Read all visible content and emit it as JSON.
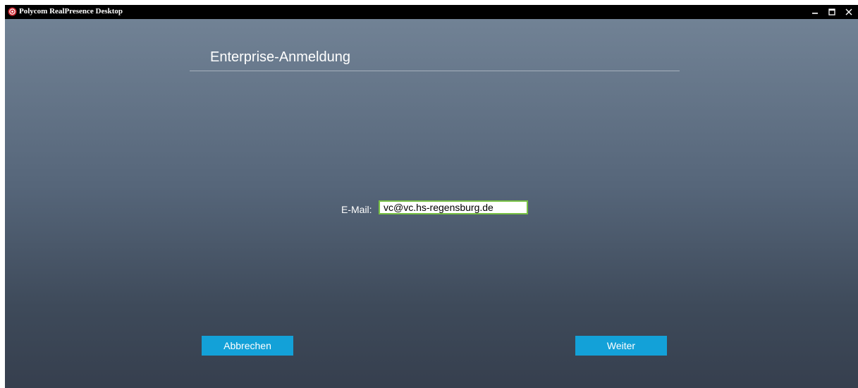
{
  "window": {
    "title": "Polycom RealPresence Desktop",
    "app_icon": "polycom-logo-icon",
    "controls": {
      "minimize": "minimize-icon",
      "maximize": "maximize-icon",
      "close": "close-icon"
    }
  },
  "page": {
    "title": "Enterprise-Anmeldung"
  },
  "form": {
    "email_label": "E-Mail:",
    "email_value": "vc@vc.hs-regensburg.de"
  },
  "buttons": {
    "cancel_label": "Abbrechen",
    "next_label": "Weiter"
  },
  "colors": {
    "accent_button": "#13a1d8",
    "input_focus_border": "#77c043",
    "app_icon_red": "#c8202a"
  }
}
